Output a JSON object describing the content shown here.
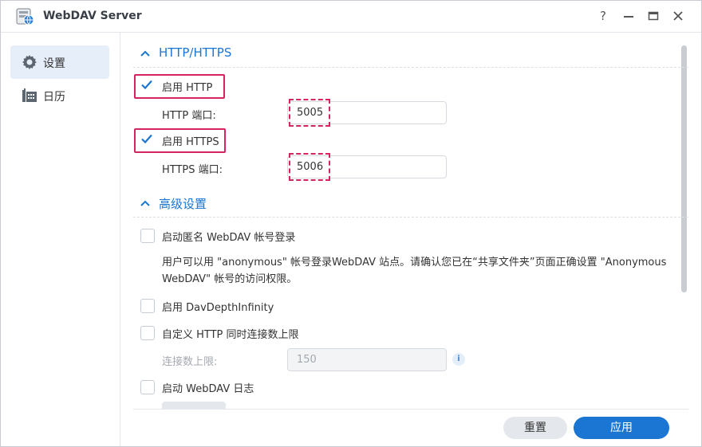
{
  "window": {
    "title": "WebDAV Server",
    "controls": {
      "help": "?",
      "minimize": "–",
      "maximize": "▭",
      "close": "✕"
    }
  },
  "sidebar": {
    "items": [
      {
        "label": "设置",
        "icon": "gear-icon",
        "active": true
      },
      {
        "label": "日历",
        "icon": "calendar-icon",
        "active": false
      }
    ]
  },
  "sections": {
    "http": {
      "title": "HTTP/HTTPS"
    },
    "advanced": {
      "title": "高级设置"
    }
  },
  "http": {
    "enable_http_label": "启用 HTTP",
    "enable_http_checked": true,
    "http_port_label": "HTTP 端口:",
    "http_port_value": "5005",
    "enable_https_label": "启用 HTTPS",
    "enable_https_checked": true,
    "https_port_label": "HTTPS 端口:",
    "https_port_value": "5006"
  },
  "advanced": {
    "anon_label": "启动匿名 WebDAV 帐号登录",
    "anon_desc": "用户可以用 \"anonymous\" 帐号登录WebDAV 站点。请确认您已在“共享文件夹”页面正确设置 \"Anonymous WebDAV\" 帐号的访问权限。",
    "depth_label": "启用 DavDepthInfinity",
    "custom_conn_label": "自定义 HTTP 同时连接数上限",
    "conn_limit_label": "连接数上限:",
    "conn_limit_value": "150",
    "log_label": "启动 WebDAV 日志"
  },
  "footer": {
    "reset_label": "重置",
    "apply_label": "应用"
  },
  "colors": {
    "accent": "#1a76d2",
    "highlight": "#d6245f"
  }
}
